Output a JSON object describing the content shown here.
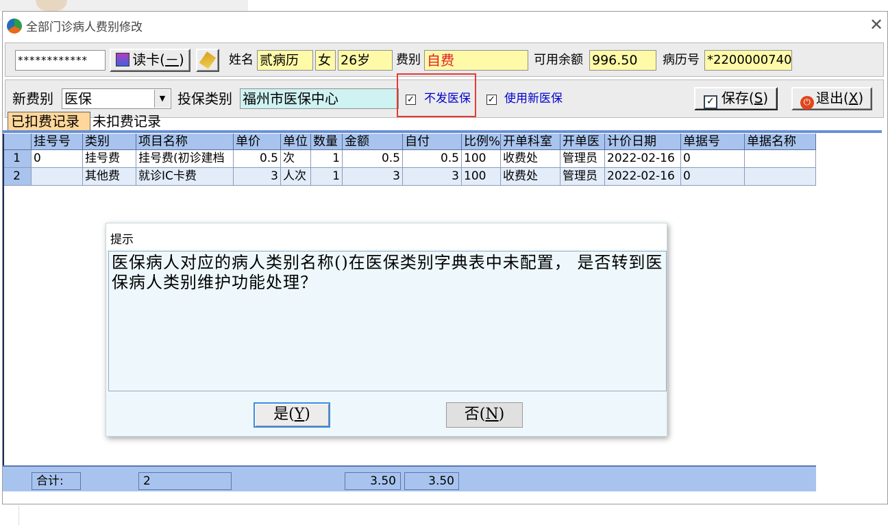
{
  "window": {
    "title": "全部门诊病人费别修改"
  },
  "patient": {
    "card_no": "************",
    "read_card_label": "读卡(",
    "read_card_key": "－",
    "read_card_close": ")",
    "name_label": "姓名",
    "name": "贰病历",
    "gender": "女",
    "age": "26岁",
    "fee_type_label": "费别",
    "fee_type": "自费",
    "balance_label": "可用余额",
    "balance": "996.50",
    "record_no_label": "病历号",
    "record_no": "*2200000740"
  },
  "insurance": {
    "new_fee_label": "新费别",
    "new_fee_value": "医保",
    "insure_type_label": "投保类别",
    "insure_type_value": "福州市医保中心",
    "no_insure_label": "不发医保",
    "no_insure_checked": "✓",
    "new_insure_label": "使用新医保",
    "new_insure_checked": "✓",
    "save_label": "保存(",
    "save_key": "S",
    "exit_label": "退出(",
    "exit_key": "X",
    "close_paren": ")"
  },
  "tabs": {
    "done": "已扣费记录",
    "todo": "未扣费记录"
  },
  "grid": {
    "headers": [
      "挂号号",
      "类别",
      "项目名称",
      "单价",
      "单位",
      "数量",
      "金额",
      "自付",
      "比例%",
      "开单科室",
      "开单医",
      "计价日期",
      "单据号",
      "单据名称"
    ],
    "rows": [
      {
        "n": "1",
        "reg": "0",
        "cat": "挂号费",
        "item": "挂号费(初诊建档",
        "price": "0.5",
        "unit": "次",
        "qty": "1",
        "amount": "0.5",
        "self": "0.5",
        "ratio": "100",
        "dept": "收费处",
        "doctor": "管理员",
        "date": "2022-02-16",
        "bill": "0",
        "bill_name": ""
      },
      {
        "n": "2",
        "reg": "",
        "cat": "其他费",
        "item": "就诊IC卡费",
        "price": "3",
        "unit": "人次",
        "qty": "1",
        "amount": "3",
        "self": "3",
        "ratio": "100",
        "dept": "收费处",
        "doctor": "管理员",
        "date": "2022-02-16",
        "bill": "0",
        "bill_name": ""
      }
    ]
  },
  "footer": {
    "total_label": "合计:",
    "count": "2",
    "amount": "3.50",
    "self": "3.50"
  },
  "dialog": {
    "title": "提示",
    "message": "医保病人对应的病人类别名称()在医保类别字典表中未配置， 是否转到医保病人类别维护功能处理？",
    "yes_label": "是(",
    "yes_key": "Y",
    "no_label": "否(",
    "no_key": "N",
    "close_paren": ")"
  }
}
